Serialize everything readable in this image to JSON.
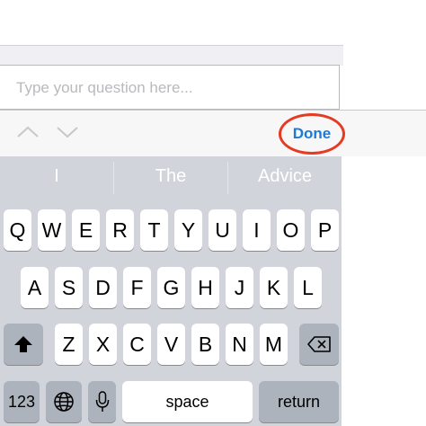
{
  "question_field": {
    "placeholder": "Type your question here..."
  },
  "accessory_bar": {
    "done_label": "Done"
  },
  "suggestions": [
    "I",
    "The",
    "Advice"
  ],
  "keyboard": {
    "row1": [
      "Q",
      "W",
      "E",
      "R",
      "T",
      "Y",
      "U",
      "I",
      "O",
      "P"
    ],
    "row2": [
      "A",
      "S",
      "D",
      "F",
      "G",
      "H",
      "J",
      "K",
      "L"
    ],
    "row3": [
      "Z",
      "X",
      "C",
      "V",
      "B",
      "N",
      "M"
    ],
    "numbers_label": "123",
    "space_label": "space",
    "return_label": "return"
  },
  "icons": {
    "shift": "shift-icon",
    "delete": "backspace-icon",
    "globe": "globe-icon",
    "mic": "microphone-icon",
    "prev": "chevron-up-icon",
    "next": "chevron-down-icon"
  },
  "colors": {
    "done": "#1a7ad6",
    "highlight_ring": "#e63a22",
    "keyboard_bg": "#d1d5db"
  }
}
